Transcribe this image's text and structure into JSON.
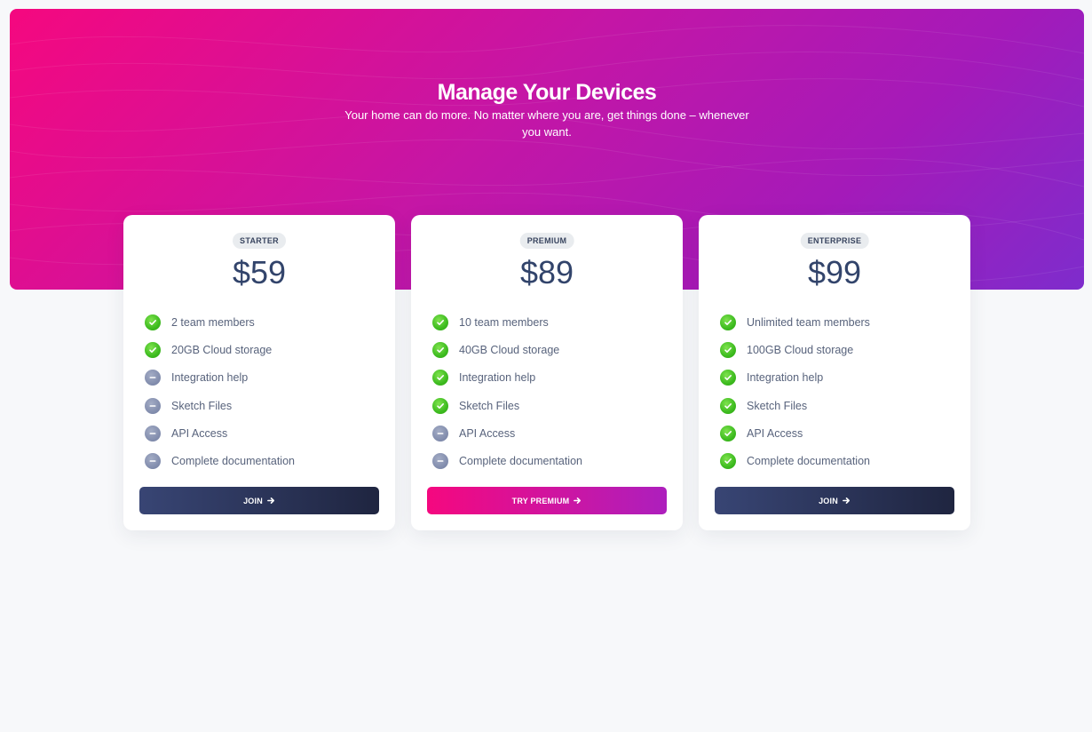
{
  "hero": {
    "title": "Manage Your Devices",
    "subtitle": "Your home can do more. No matter where you are, get things done – whenever you want."
  },
  "colors": {
    "hero_gradient_start": "#f5087f",
    "hero_gradient_end": "#7e2ccc",
    "price_text": "#32446b",
    "check_green": "#3dbb1f",
    "dash_gray": "#7f8aab",
    "dark_button": "#1f2540",
    "page_background": "#f7f8fa"
  },
  "plans": [
    {
      "badge": "STARTER",
      "price": "$59",
      "button": "JOIN",
      "features": [
        {
          "label": "2 team members",
          "icon": "check-icon"
        },
        {
          "label": "20GB Cloud storage",
          "icon": "check-icon"
        },
        {
          "label": "Integration help",
          "icon": "minus-icon"
        },
        {
          "label": "Sketch Files",
          "icon": "minus-icon"
        },
        {
          "label": "API Access",
          "icon": "minus-icon"
        },
        {
          "label": "Complete documentation",
          "icon": "minus-icon"
        }
      ]
    },
    {
      "badge": "PREMIUM",
      "price": "$89",
      "button": "TRY PREMIUM",
      "features": [
        {
          "label": "10 team members",
          "icon": "check-icon"
        },
        {
          "label": "40GB Cloud storage",
          "icon": "check-icon"
        },
        {
          "label": "Integration help",
          "icon": "check-icon"
        },
        {
          "label": "Sketch Files",
          "icon": "check-icon"
        },
        {
          "label": "API Access",
          "icon": "minus-icon"
        },
        {
          "label": "Complete documentation",
          "icon": "minus-icon"
        }
      ]
    },
    {
      "badge": "ENTERPRISE",
      "price": "$99",
      "button": "JOIN",
      "features": [
        {
          "label": "Unlimited team members",
          "icon": "check-icon"
        },
        {
          "label": "100GB Cloud storage",
          "icon": "check-icon"
        },
        {
          "label": "Integration help",
          "icon": "check-icon"
        },
        {
          "label": "Sketch Files",
          "icon": "check-icon"
        },
        {
          "label": "API Access",
          "icon": "check-icon"
        },
        {
          "label": "Complete documentation",
          "icon": "check-icon"
        }
      ]
    }
  ]
}
